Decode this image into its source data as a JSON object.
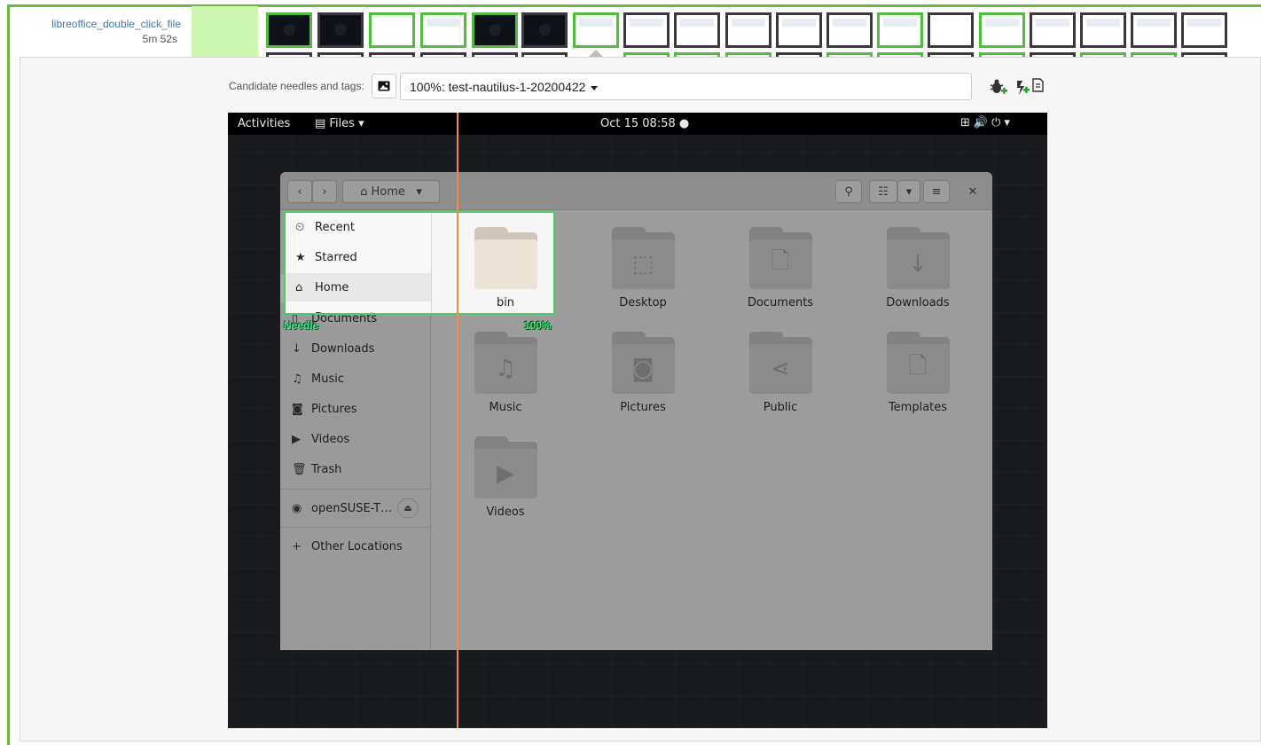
{
  "test_row": {
    "name": "libreoffice_double_click_file",
    "duration": "5m 52s"
  },
  "candidates": {
    "label": "Candidate needles and tags:",
    "selected": "100%: test-nautilus-1-20200422"
  },
  "vm": {
    "topbar": {
      "activities": "Activities",
      "app_menu": "Files",
      "clock": "Oct 15  08:58"
    },
    "nautilus": {
      "location": "Home",
      "sidebar": [
        {
          "icon": "clock-icon",
          "glyph": "⏲",
          "label": "Recent"
        },
        {
          "icon": "star-icon",
          "glyph": "★",
          "label": "Starred"
        },
        {
          "icon": "home-icon",
          "glyph": "⌂",
          "label": "Home"
        },
        {
          "icon": "document-icon",
          "glyph": "▯",
          "label": "Documents"
        },
        {
          "icon": "download-icon",
          "glyph": "↓",
          "label": "Downloads"
        },
        {
          "icon": "music-icon",
          "glyph": "♫",
          "label": "Music"
        },
        {
          "icon": "camera-icon",
          "glyph": "◙",
          "label": "Pictures"
        },
        {
          "icon": "video-icon",
          "glyph": "▶",
          "label": "Videos"
        },
        {
          "icon": "trash-icon",
          "glyph": "🗑",
          "label": "Trash"
        }
      ],
      "device": "openSUSE-T…",
      "other_locations": "Other Locations",
      "folders": [
        {
          "name": "bin",
          "glyph": ""
        },
        {
          "name": "Desktop",
          "glyph": "⬚"
        },
        {
          "name": "Documents",
          "glyph": "🗋"
        },
        {
          "name": "Downloads",
          "glyph": "↓"
        },
        {
          "name": "Music",
          "glyph": "♫"
        },
        {
          "name": "Pictures",
          "glyph": "◙"
        },
        {
          "name": "Public",
          "glyph": "⋖"
        },
        {
          "name": "Templates",
          "glyph": "🗋"
        },
        {
          "name": "Videos",
          "glyph": "▶"
        }
      ]
    }
  },
  "needle": {
    "tag": "Needle",
    "match": "100%"
  },
  "colors": {
    "pass_border": "#6cb542",
    "needle_green": "#50c86a",
    "cursor_line": "#f08c4a"
  }
}
